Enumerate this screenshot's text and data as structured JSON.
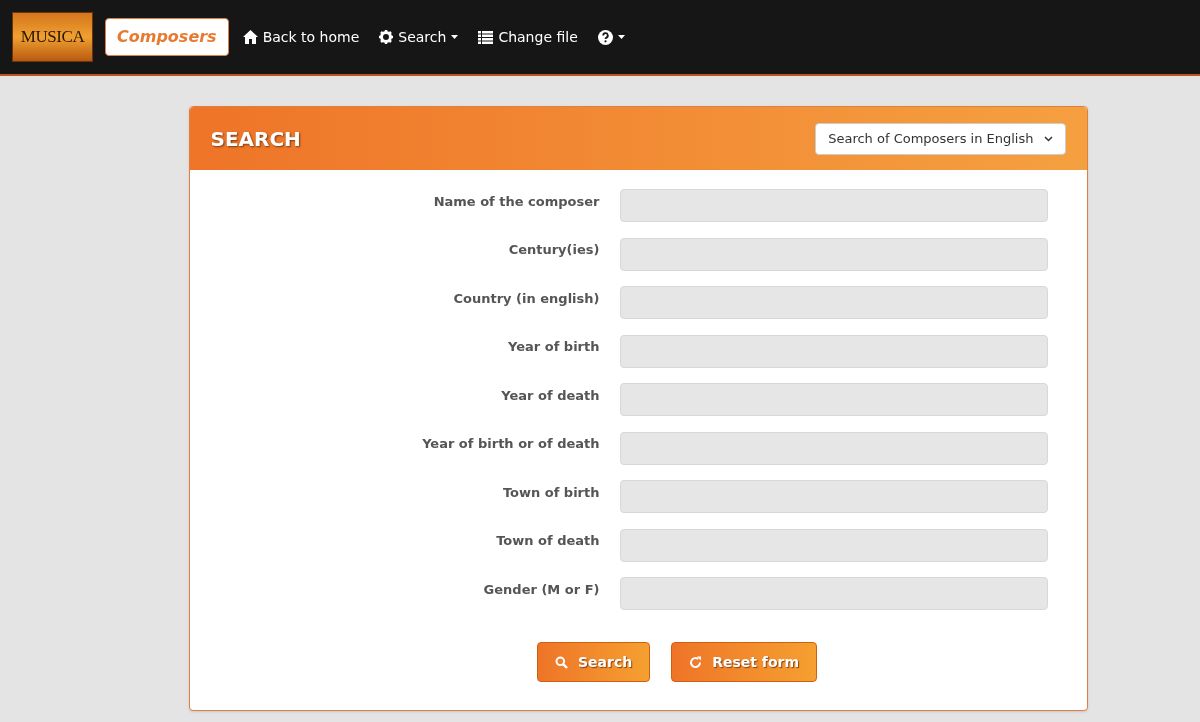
{
  "navbar": {
    "logo": "MUSICA",
    "brand": "Composers",
    "items": [
      {
        "kind": "link",
        "label": "Back to home"
      },
      {
        "kind": "dropdown",
        "label": "Search"
      },
      {
        "kind": "link",
        "label": "Change file"
      },
      {
        "kind": "dropdown"
      }
    ]
  },
  "panel": {
    "title": "SEARCH",
    "select": "Search of Composers in English",
    "fields": [
      {
        "label": "Name of the composer"
      },
      {
        "label": "Century(ies)"
      },
      {
        "label": "Country (in english)"
      },
      {
        "label": "Year of birth"
      },
      {
        "label": "Year of death"
      },
      {
        "label": "Year of birth or of death"
      },
      {
        "label": "Town of birth"
      },
      {
        "label": "Town of death"
      },
      {
        "label": "Gender (M or F)"
      }
    ],
    "buttons": [
      {
        "label": "Search"
      },
      {
        "label": "Reset form"
      }
    ]
  }
}
